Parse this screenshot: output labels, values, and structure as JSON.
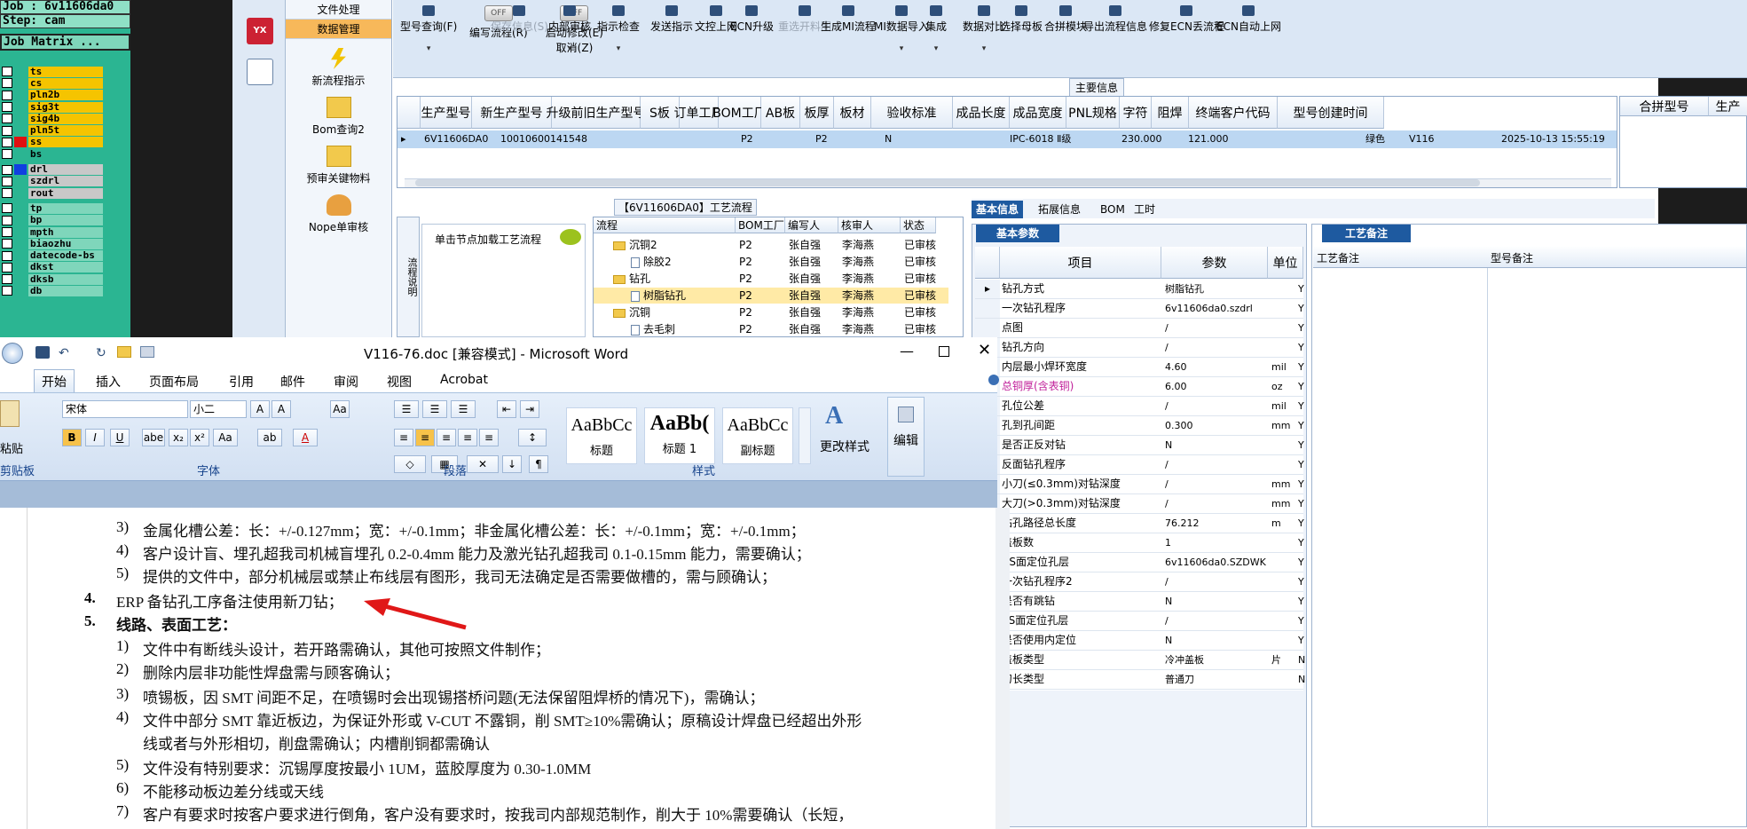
{
  "genesis": {
    "job": "Job : 6v11606da0",
    "step": "Step: cam",
    "matrix": "Job Matrix ...",
    "layers": [
      {
        "name": "ts",
        "color": "#f5c400",
        "mark": "#2bb592"
      },
      {
        "name": "cs",
        "color": "#f5c400",
        "mark": "#2bb592"
      },
      {
        "name": "pln2b",
        "color": "#f5c400",
        "mark": "#2bb592"
      },
      {
        "name": "sig3t",
        "color": "#f5c400",
        "mark": "#2bb592"
      },
      {
        "name": "sig4b",
        "color": "#f5c400",
        "mark": "#2bb592"
      },
      {
        "name": "pln5t",
        "color": "#f5c400",
        "mark": "#2bb592"
      },
      {
        "name": "ss",
        "color": "#f5c400",
        "mark": "#e01010"
      },
      {
        "name": "bs",
        "color": "#2bb592",
        "mark": "#2bb592"
      },
      {
        "name": "drl",
        "color": "#c8c8c8",
        "mark": "#1040e0"
      },
      {
        "name": "szdrl",
        "color": "#c8c8c8",
        "mark": "#2bb592"
      },
      {
        "name": "rout",
        "color": "#c8c8c8",
        "mark": "#2bb592"
      },
      {
        "name": "tp",
        "color": "#7fd6bb",
        "mark": "#2bb592"
      },
      {
        "name": "bp",
        "color": "#7fd6bb",
        "mark": "#2bb592"
      },
      {
        "name": "mpth",
        "color": "#7fd6bb",
        "mark": "#2bb592"
      },
      {
        "name": "biaozhu",
        "color": "#7fd6bb",
        "mark": "#2bb592"
      },
      {
        "name": "datecode-bs",
        "color": "#7fd6bb",
        "mark": "#2bb592"
      },
      {
        "name": "dkst",
        "color": "#7fd6bb",
        "mark": "#2bb592"
      },
      {
        "name": "dksb",
        "color": "#7fd6bb",
        "mark": "#2bb592"
      },
      {
        "name": "db",
        "color": "#7fd6bb",
        "mark": "#2bb592"
      }
    ]
  },
  "erp": {
    "nav": {
      "tab1": "文件处理",
      "tab2": "数据管理",
      "items": [
        "新流程指示",
        "Bom查询2",
        "预审关键物料",
        "Nope单审核"
      ]
    },
    "toolbar": {
      "b1": "型号查询(F)",
      "t1": "OFF",
      "b2": "编写流程(R)",
      "t2": "OFF",
      "b3": "启动修改(E)",
      "b3b": "取消(Z)",
      "items": [
        "保存信息(S)",
        "内部审核",
        "指示检查",
        "发送指示",
        "文控上网",
        "ECN升级",
        "重选开料图",
        "生成MI流程",
        "MI数据导入",
        "集成",
        "数据对比",
        "选择母板",
        "合拼模块",
        "导出流程信息",
        "修复ECN丢流程",
        "ECN自动上网"
      ]
    },
    "main_label": "主要信息",
    "grid_headers": [
      "生产型号",
      "新生产型号",
      "升级前旧生产型号",
      "S板",
      "订单工厂",
      "BOM工厂",
      "AB板",
      "板厚",
      "板材",
      "验收标准",
      "成品长度",
      "成品宽度",
      "PNL规格",
      "字符",
      "阻焊",
      "终端客户代码",
      "型号创建时间"
    ],
    "grid_right_headers": [
      "合拼型号",
      "生产"
    ],
    "grid_row": {
      "c1": "6V11606DA0",
      "c2": "10010600141548",
      "c3": "P2",
      "c4": "P2",
      "c5": "N",
      "c6": "IPC-6018 Ⅱ级",
      "c7": "230.000",
      "c8": "121.000",
      "c9": "绿色",
      "c10": "V116",
      "c11": "2025-10-13 15:55:19"
    },
    "process_label": "【6V11606DA0】工艺流程",
    "process_side": "流程说明",
    "process_msg": "单击节点加载工艺流程",
    "proc_headers": [
      "流程",
      "BOM工厂",
      "编写人",
      "核审人",
      "状态"
    ],
    "proc_rows": [
      {
        "name": "沉铜2",
        "type": "folder",
        "f": "P2",
        "w": "张自强",
        "r": "李海燕",
        "s": "已审核"
      },
      {
        "name": "除胶2",
        "type": "doc",
        "f": "P2",
        "w": "张自强",
        "r": "李海燕",
        "s": "已审核"
      },
      {
        "name": "钻孔",
        "type": "folder",
        "f": "P2",
        "w": "张自强",
        "r": "李海燕",
        "s": "已审核"
      },
      {
        "name": "树脂钻孔",
        "type": "doc",
        "f": "P2",
        "w": "张自强",
        "r": "李海燕",
        "s": "已审核"
      },
      {
        "name": "沉铜",
        "type": "folder",
        "f": "P2",
        "w": "张自强",
        "r": "李海燕",
        "s": "已审核"
      },
      {
        "name": "去毛刺",
        "type": "doc",
        "f": "P2",
        "w": "张自强",
        "r": "李海燕",
        "s": "已审核"
      }
    ],
    "right_tabs": [
      "基本信息",
      "拓展信息",
      "BOM",
      "工时"
    ],
    "basic_label": "基本参数",
    "param_headers": [
      "项目",
      "参数",
      "单位"
    ],
    "params": [
      {
        "k": "钻孔方式",
        "v": "树脂钻孔",
        "u": "",
        "f": "Y"
      },
      {
        "k": "一次钻孔程序",
        "v": "6v11606da0.szdrl",
        "u": "",
        "f": "Y"
      },
      {
        "k": "点图",
        "v": "/",
        "u": "",
        "f": "Y"
      },
      {
        "k": "钻孔方向",
        "v": "/",
        "u": "",
        "f": "Y"
      },
      {
        "k": "内层最小焊环宽度",
        "v": "4.60",
        "u": "mil",
        "f": "Y"
      },
      {
        "k": "总铜厚(含表铜)",
        "v": "6.00",
        "u": "oz",
        "f": "Y"
      },
      {
        "k": "孔位公差",
        "v": "/",
        "u": "mil",
        "f": "Y"
      },
      {
        "k": "孔到孔间距",
        "v": "0.300",
        "u": "mm",
        "f": "Y"
      },
      {
        "k": "是否正反对钻",
        "v": "N",
        "u": "",
        "f": "Y"
      },
      {
        "k": "反面钻孔程序",
        "v": "/",
        "u": "",
        "f": "Y"
      },
      {
        "k": "小刀(≤0.3mm)对钻深度",
        "v": "/",
        "u": "mm",
        "f": "Y"
      },
      {
        "k": "大刀(>0.3mm)对钻深度",
        "v": "/",
        "u": "mm",
        "f": "Y"
      },
      {
        "k": "钻孔路径总长度",
        "v": "76.212",
        "u": "m",
        "f": "Y"
      },
      {
        "k": "盖板数",
        "v": "1",
        "u": "",
        "f": "Y"
      },
      {
        "k": "CS面定位孔层",
        "v": "6v11606da0.SZDWK",
        "u": "",
        "f": "Y"
      },
      {
        "k": "一次钻孔程序2",
        "v": "/",
        "u": "",
        "f": "Y"
      },
      {
        "k": "是否有跳钻",
        "v": "N",
        "u": "",
        "f": "Y"
      },
      {
        "k": "SS面定位孔层",
        "v": "/",
        "u": "",
        "f": "Y"
      },
      {
        "k": "是否使用内定位",
        "v": "N",
        "u": "",
        "f": "Y"
      },
      {
        "k": "盖板类型",
        "v": "冷冲盖板",
        "u": "片",
        "f": "N"
      },
      {
        "k": "刀长类型",
        "v": "普通刀",
        "u": "",
        "f": "N"
      }
    ],
    "note_label": "工艺备注",
    "note_cols": [
      "工艺备注",
      "型号备注"
    ]
  },
  "word": {
    "title": "V116-76.doc [兼容模式] - Microsoft Word",
    "tabs": [
      "开始",
      "插入",
      "页面布局",
      "引用",
      "邮件",
      "审阅",
      "视图",
      "Acrobat"
    ],
    "font": "宋体",
    "size": "小二",
    "groups": [
      "剪贴板",
      "字体",
      "段落",
      "样式",
      "编辑"
    ],
    "paste": "粘贴",
    "styles": [
      {
        "sample": "AaBbCc",
        "name": "标题"
      },
      {
        "sample": "AaBb(",
        "name": "标题 1"
      },
      {
        "sample": "AaBbCc",
        "name": "副标题"
      }
    ],
    "change_styles": "更改样式",
    "edit": "编辑",
    "lines": [
      {
        "n": "3)",
        "t": "金属化槽公差：长：+/-0.127mm；宽：+/-0.1mm；非金属化槽公差：长：+/-0.1mm；宽：+/-0.1mm；"
      },
      {
        "n": "4)",
        "t": "客户设计盲、埋孔超我司机械盲埋孔 0.2-0.4mm 能力及激光钻孔超我司 0.1-0.15mm 能力，需要确认；"
      },
      {
        "n": "5)",
        "t": "提供的文件中，部分机械层或禁止布线层有图形，我司无法确定是否需要做槽的，需与顾确认；"
      },
      {
        "n": "4.",
        "t": "ERP 备钻孔工序备注使用新刀钻；"
      },
      {
        "n": "5.",
        "t": "线路、表面工艺："
      },
      {
        "n": "1)",
        "t": "文件中有断线头设计，若开路需确认，其他可按照文件制作；"
      },
      {
        "n": "2)",
        "t": "删除内层非功能性焊盘需与顾客确认；"
      },
      {
        "n": "3)",
        "t": "喷锡板，因 SMT 间距不足，在喷锡时会出现锡搭桥问题(无法保留阻焊桥的情况下)，需确认；"
      },
      {
        "n": "4)",
        "t": "文件中部分 SMT 靠近板边，为保证外形或 V-CUT 不露铜，削 SMT≥10%需确认；原稿设计焊盘已经超出外形"
      },
      {
        "n": "",
        "t": "线或者与外形相切，削盘需确认；内槽削铜都需确认"
      },
      {
        "n": "5)",
        "t": "文件没有特别要求：沉锡厚度按最小 1UM，蓝胶厚度为 0.30-1.0MM"
      },
      {
        "n": "6)",
        "t": "不能移动板边差分线或天线"
      },
      {
        "n": "7)",
        "t": "客户有要求时按客户要求进行倒角，客户没有要求时，按我司内部规范制作，削大于 10%需要确认（长短，"
      }
    ]
  }
}
